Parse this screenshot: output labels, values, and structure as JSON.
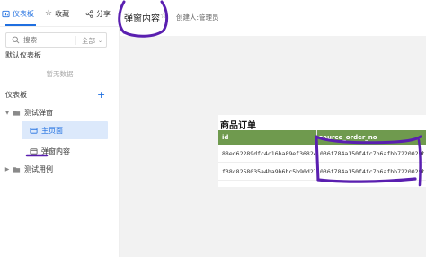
{
  "tabs": [
    {
      "label": "仪表板",
      "icon": "dashboard-icon",
      "active": true
    },
    {
      "label": "收藏",
      "icon": "star-icon",
      "active": false
    },
    {
      "label": "分享",
      "icon": "share-icon",
      "active": false
    }
  ],
  "sidebar": {
    "search_placeholder": "搜索",
    "filter_value": "全部",
    "default_dashboard_title": "默认仪表板",
    "empty_text": "暂无数据",
    "dashboard_title": "仪表板",
    "tree": [
      {
        "label": "测试弹窗",
        "type": "folder",
        "expanded": true
      },
      {
        "label": "主页面",
        "type": "page",
        "selected": true
      },
      {
        "label": "弹窗内容",
        "type": "page",
        "selected": false
      },
      {
        "label": "测试用例",
        "type": "folder",
        "expanded": false
      }
    ]
  },
  "main": {
    "title": "弹窗内容",
    "creator": "创建人:管理员",
    "table": {
      "title": "商品订单",
      "columns": [
        "id",
        "source_order_no"
      ],
      "rows": [
        [
          "88ed62289dfc4c16ba89ef36824a6...",
          "036f784a150f4fc7b6afbb7220029b..."
        ],
        [
          "f38c8258035a4ba9b6bc5b90d27b6...",
          "036f784a150f4fc7b6afbb7220029b..."
        ]
      ]
    }
  },
  "colors": {
    "accent": "#1f6fe0",
    "header_green": "#6f9a4e",
    "annotation_purple": "#5a1fb0"
  }
}
